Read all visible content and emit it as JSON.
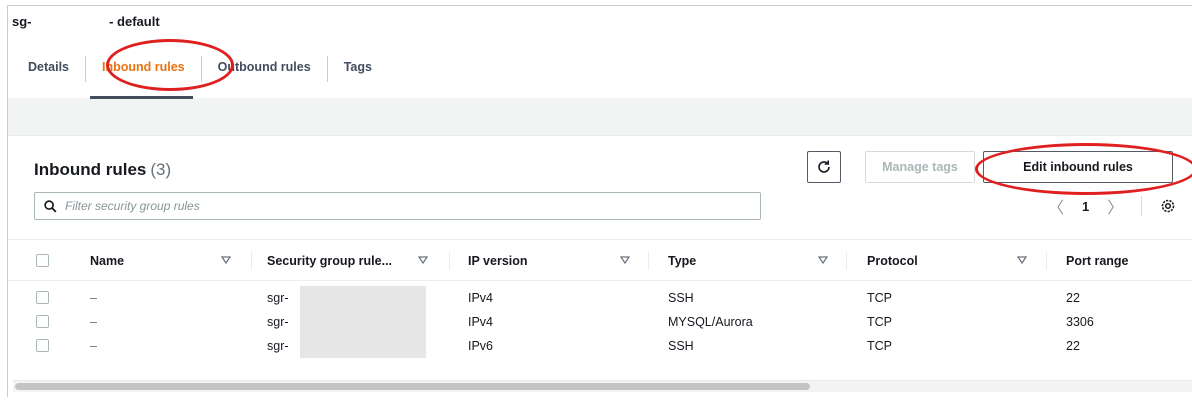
{
  "header": {
    "sg_prefix": "sg-",
    "sg_suffix": " - default"
  },
  "tabs": [
    {
      "label": "Details",
      "active": false
    },
    {
      "label": "Inbound rules",
      "active": true
    },
    {
      "label": "Outbound rules",
      "active": false
    },
    {
      "label": "Tags",
      "active": false
    }
  ],
  "panel": {
    "title": "Inbound rules",
    "count": "(3)",
    "refresh_icon": "refresh-icon",
    "manage_tags_label": "Manage tags",
    "edit_label": "Edit inbound rules",
    "filter_placeholder": "Filter security group rules",
    "page_number": "1",
    "prev": "〈",
    "next": "〉"
  },
  "table": {
    "columns": [
      "Name",
      "Security group rule...",
      "IP version",
      "Type",
      "Protocol",
      "Port range"
    ],
    "rows": [
      {
        "name": "–",
        "rule_id": "sgr-",
        "ip_version": "IPv4",
        "type": "SSH",
        "protocol": "TCP",
        "port_range": "22"
      },
      {
        "name": "–",
        "rule_id": "sgr-",
        "ip_version": "IPv4",
        "type": "MYSQL/Aurora",
        "protocol": "TCP",
        "port_range": "3306"
      },
      {
        "name": "–",
        "rule_id": "sgr-",
        "ip_version": "IPv6",
        "type": "SSH",
        "protocol": "TCP",
        "port_range": "22"
      }
    ]
  },
  "colors": {
    "active_tab": "#ec7211",
    "annotation": "#e02020"
  }
}
